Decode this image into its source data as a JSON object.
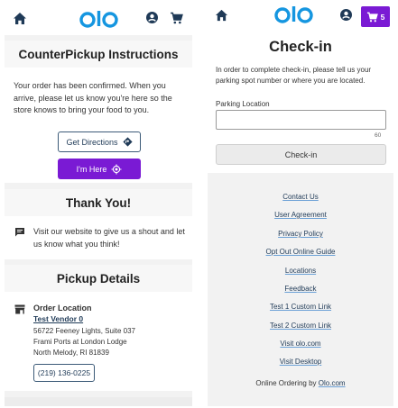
{
  "colors": {
    "brand_blue": "#1596e0",
    "accent_purple": "#7a1ad4",
    "navy": "#1f3a57"
  },
  "left": {
    "header": {
      "logo": "olo",
      "icons": [
        "home-icon",
        "account-icon",
        "cart-icon"
      ]
    },
    "instructions": {
      "title": "CounterPickup Instructions",
      "body": "Your order has been confirmed. When you arrive, please let us know you're here so the store knows to bring your food to you.",
      "directions_label": "Get Directions",
      "here_label": "I'm Here"
    },
    "thanks": {
      "title": "Thank You!",
      "body": "Visit our website to give us a shout and let us know what you think!"
    },
    "pickup": {
      "title": "Pickup Details",
      "location_label": "Order Location",
      "vendor": "Test Vendor 0",
      "address_line1": "56722 Feeney Lights, Suite 037",
      "address_line2": "Frami Ports at London Lodge",
      "address_line3": "North Melody, RI 81839",
      "phone": "(219) 136-0225"
    }
  },
  "right": {
    "header": {
      "logo": "olo",
      "cart_count": "5"
    },
    "checkin": {
      "title": "Check-in",
      "description": "In order to complete check-in, please tell us your parking spot number or where you are located.",
      "field_label": "Parking Location",
      "field_value": "",
      "char_limit": "60",
      "button_label": "Check-in"
    },
    "footer": {
      "links": [
        "Contact Us",
        "User Agreement",
        "Privacy Policy",
        "Opt Out Online Guide",
        "Locations",
        "Feedback",
        "Test 1 Custom Link",
        "Test 2 Custom Link",
        "Visit olo.com",
        "Visit Desktop"
      ],
      "powered_prefix": "Online Ordering by",
      "powered_link": "Olo.com"
    }
  }
}
